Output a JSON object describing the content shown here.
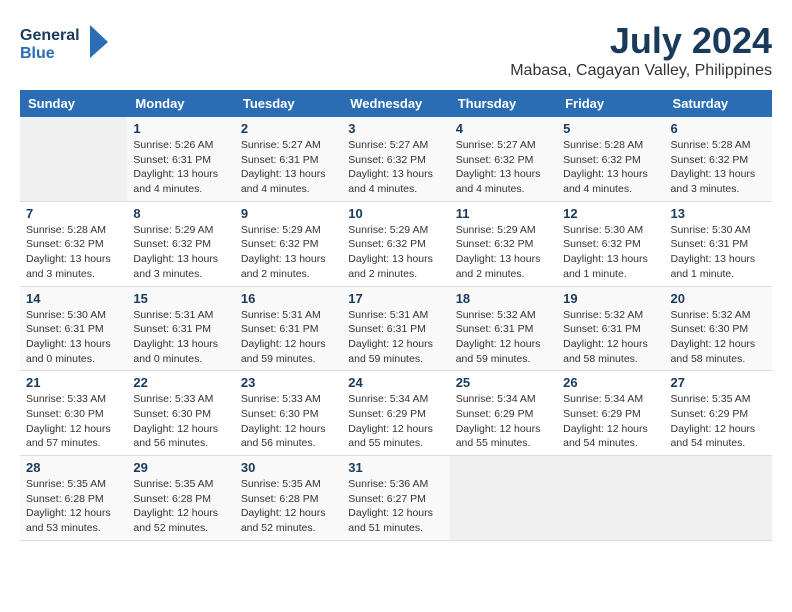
{
  "logo": {
    "line1": "General",
    "line2": "Blue"
  },
  "title": "July 2024",
  "subtitle": "Mabasa, Cagayan Valley, Philippines",
  "headers": [
    "Sunday",
    "Monday",
    "Tuesday",
    "Wednesday",
    "Thursday",
    "Friday",
    "Saturday"
  ],
  "weeks": [
    [
      {
        "day": "",
        "empty": true
      },
      {
        "day": "1",
        "sunrise": "Sunrise: 5:26 AM",
        "sunset": "Sunset: 6:31 PM",
        "daylight": "Daylight: 13 hours and 4 minutes."
      },
      {
        "day": "2",
        "sunrise": "Sunrise: 5:27 AM",
        "sunset": "Sunset: 6:31 PM",
        "daylight": "Daylight: 13 hours and 4 minutes."
      },
      {
        "day": "3",
        "sunrise": "Sunrise: 5:27 AM",
        "sunset": "Sunset: 6:32 PM",
        "daylight": "Daylight: 13 hours and 4 minutes."
      },
      {
        "day": "4",
        "sunrise": "Sunrise: 5:27 AM",
        "sunset": "Sunset: 6:32 PM",
        "daylight": "Daylight: 13 hours and 4 minutes."
      },
      {
        "day": "5",
        "sunrise": "Sunrise: 5:28 AM",
        "sunset": "Sunset: 6:32 PM",
        "daylight": "Daylight: 13 hours and 4 minutes."
      },
      {
        "day": "6",
        "sunrise": "Sunrise: 5:28 AM",
        "sunset": "Sunset: 6:32 PM",
        "daylight": "Daylight: 13 hours and 3 minutes."
      }
    ],
    [
      {
        "day": "7",
        "sunrise": "Sunrise: 5:28 AM",
        "sunset": "Sunset: 6:32 PM",
        "daylight": "Daylight: 13 hours and 3 minutes."
      },
      {
        "day": "8",
        "sunrise": "Sunrise: 5:29 AM",
        "sunset": "Sunset: 6:32 PM",
        "daylight": "Daylight: 13 hours and 3 minutes."
      },
      {
        "day": "9",
        "sunrise": "Sunrise: 5:29 AM",
        "sunset": "Sunset: 6:32 PM",
        "daylight": "Daylight: 13 hours and 2 minutes."
      },
      {
        "day": "10",
        "sunrise": "Sunrise: 5:29 AM",
        "sunset": "Sunset: 6:32 PM",
        "daylight": "Daylight: 13 hours and 2 minutes."
      },
      {
        "day": "11",
        "sunrise": "Sunrise: 5:29 AM",
        "sunset": "Sunset: 6:32 PM",
        "daylight": "Daylight: 13 hours and 2 minutes."
      },
      {
        "day": "12",
        "sunrise": "Sunrise: 5:30 AM",
        "sunset": "Sunset: 6:32 PM",
        "daylight": "Daylight: 13 hours and 1 minute."
      },
      {
        "day": "13",
        "sunrise": "Sunrise: 5:30 AM",
        "sunset": "Sunset: 6:31 PM",
        "daylight": "Daylight: 13 hours and 1 minute."
      }
    ],
    [
      {
        "day": "14",
        "sunrise": "Sunrise: 5:30 AM",
        "sunset": "Sunset: 6:31 PM",
        "daylight": "Daylight: 13 hours and 0 minutes."
      },
      {
        "day": "15",
        "sunrise": "Sunrise: 5:31 AM",
        "sunset": "Sunset: 6:31 PM",
        "daylight": "Daylight: 13 hours and 0 minutes."
      },
      {
        "day": "16",
        "sunrise": "Sunrise: 5:31 AM",
        "sunset": "Sunset: 6:31 PM",
        "daylight": "Daylight: 12 hours and 59 minutes."
      },
      {
        "day": "17",
        "sunrise": "Sunrise: 5:31 AM",
        "sunset": "Sunset: 6:31 PM",
        "daylight": "Daylight: 12 hours and 59 minutes."
      },
      {
        "day": "18",
        "sunrise": "Sunrise: 5:32 AM",
        "sunset": "Sunset: 6:31 PM",
        "daylight": "Daylight: 12 hours and 59 minutes."
      },
      {
        "day": "19",
        "sunrise": "Sunrise: 5:32 AM",
        "sunset": "Sunset: 6:31 PM",
        "daylight": "Daylight: 12 hours and 58 minutes."
      },
      {
        "day": "20",
        "sunrise": "Sunrise: 5:32 AM",
        "sunset": "Sunset: 6:30 PM",
        "daylight": "Daylight: 12 hours and 58 minutes."
      }
    ],
    [
      {
        "day": "21",
        "sunrise": "Sunrise: 5:33 AM",
        "sunset": "Sunset: 6:30 PM",
        "daylight": "Daylight: 12 hours and 57 minutes."
      },
      {
        "day": "22",
        "sunrise": "Sunrise: 5:33 AM",
        "sunset": "Sunset: 6:30 PM",
        "daylight": "Daylight: 12 hours and 56 minutes."
      },
      {
        "day": "23",
        "sunrise": "Sunrise: 5:33 AM",
        "sunset": "Sunset: 6:30 PM",
        "daylight": "Daylight: 12 hours and 56 minutes."
      },
      {
        "day": "24",
        "sunrise": "Sunrise: 5:34 AM",
        "sunset": "Sunset: 6:29 PM",
        "daylight": "Daylight: 12 hours and 55 minutes."
      },
      {
        "day": "25",
        "sunrise": "Sunrise: 5:34 AM",
        "sunset": "Sunset: 6:29 PM",
        "daylight": "Daylight: 12 hours and 55 minutes."
      },
      {
        "day": "26",
        "sunrise": "Sunrise: 5:34 AM",
        "sunset": "Sunset: 6:29 PM",
        "daylight": "Daylight: 12 hours and 54 minutes."
      },
      {
        "day": "27",
        "sunrise": "Sunrise: 5:35 AM",
        "sunset": "Sunset: 6:29 PM",
        "daylight": "Daylight: 12 hours and 54 minutes."
      }
    ],
    [
      {
        "day": "28",
        "sunrise": "Sunrise: 5:35 AM",
        "sunset": "Sunset: 6:28 PM",
        "daylight": "Daylight: 12 hours and 53 minutes."
      },
      {
        "day": "29",
        "sunrise": "Sunrise: 5:35 AM",
        "sunset": "Sunset: 6:28 PM",
        "daylight": "Daylight: 12 hours and 52 minutes."
      },
      {
        "day": "30",
        "sunrise": "Sunrise: 5:35 AM",
        "sunset": "Sunset: 6:28 PM",
        "daylight": "Daylight: 12 hours and 52 minutes."
      },
      {
        "day": "31",
        "sunrise": "Sunrise: 5:36 AM",
        "sunset": "Sunset: 6:27 PM",
        "daylight": "Daylight: 12 hours and 51 minutes."
      },
      {
        "day": "",
        "empty": true
      },
      {
        "day": "",
        "empty": true
      },
      {
        "day": "",
        "empty": true
      }
    ]
  ]
}
